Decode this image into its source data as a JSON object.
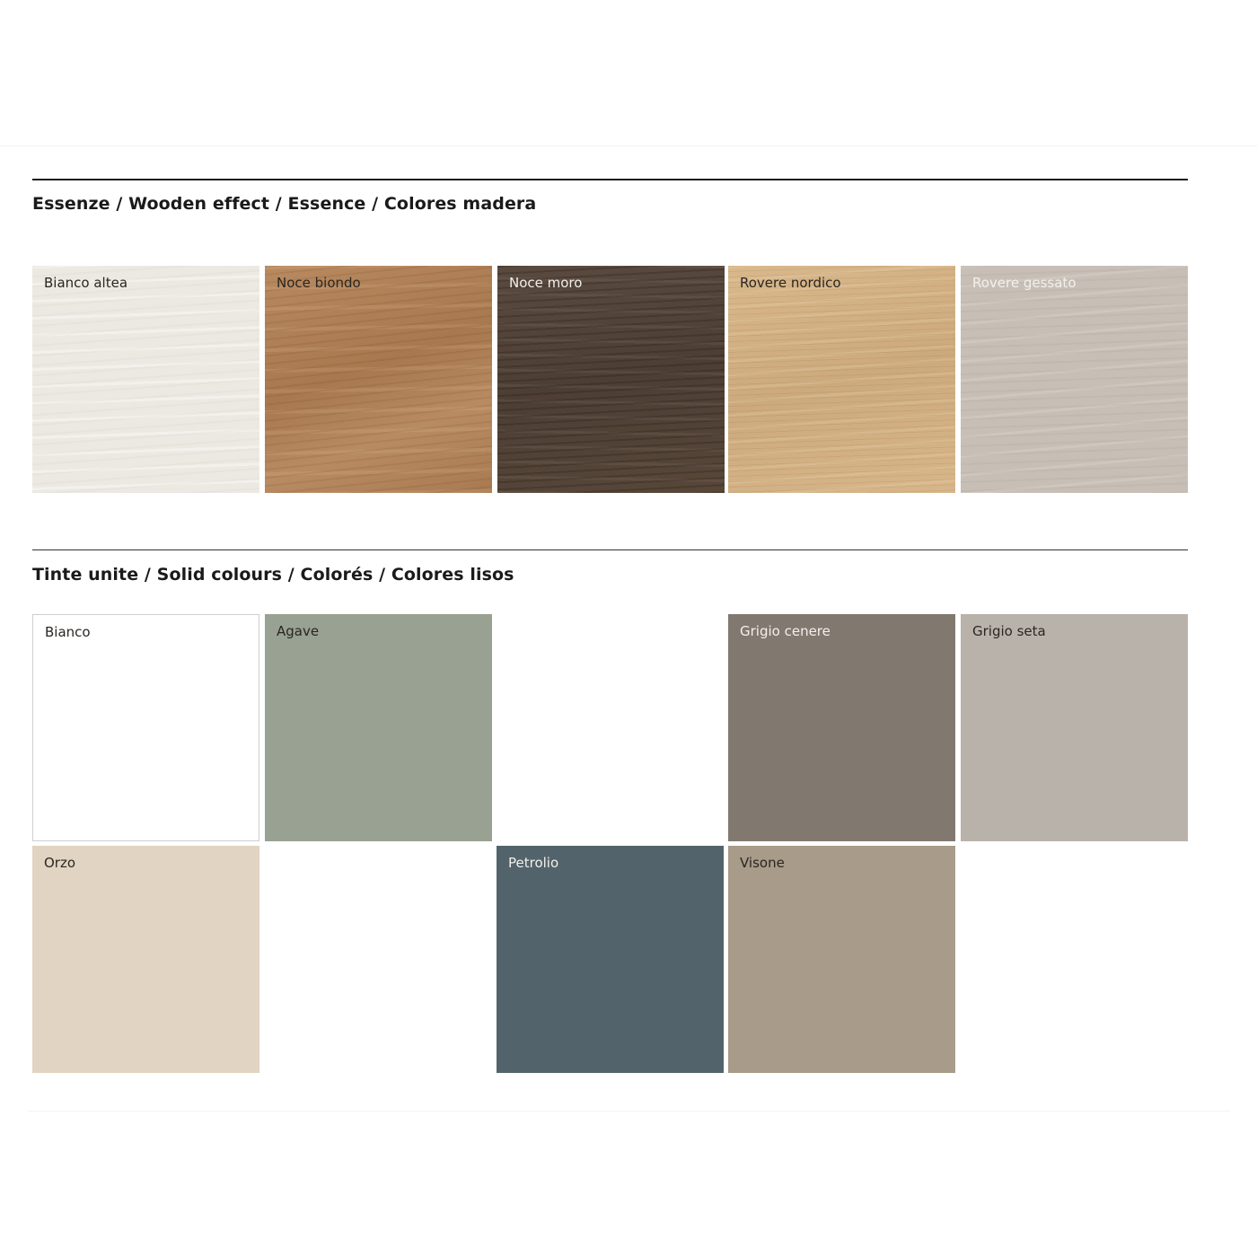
{
  "sections": [
    {
      "title": "Essenze / Wooden effect / Essence / Colores madera",
      "swatches": [
        {
          "label": "Bianco altea",
          "color": "#ece9e2",
          "texture": "wood"
        },
        {
          "label": "Noce biondo",
          "color": "#b07f55",
          "texture": "wood"
        },
        {
          "label": "Noce moro",
          "color": "#54443a",
          "texture": "wood"
        },
        {
          "label": "Rovere nordico",
          "color": "#d3b285",
          "texture": "wood"
        },
        {
          "label": "Rovere gessato",
          "color": "#c7bfb6",
          "texture": "wood"
        }
      ]
    },
    {
      "title": "Tinte unite / Solid colours / Colorés / Colores lisos",
      "swatches": [
        {
          "label": "Bianco",
          "color": "#ffffff"
        },
        {
          "label": "Agave",
          "color": "#98a192"
        },
        {
          "label": "Grigio cenere",
          "color": "#817970"
        },
        {
          "label": "Grigio seta",
          "color": "#b8b2aa"
        },
        {
          "label": "Orzo",
          "color": "#e1d4c2"
        },
        {
          "label": "Petrolio",
          "color": "#53636b"
        },
        {
          "label": "Visone",
          "color": "#a89b89"
        }
      ]
    }
  ]
}
